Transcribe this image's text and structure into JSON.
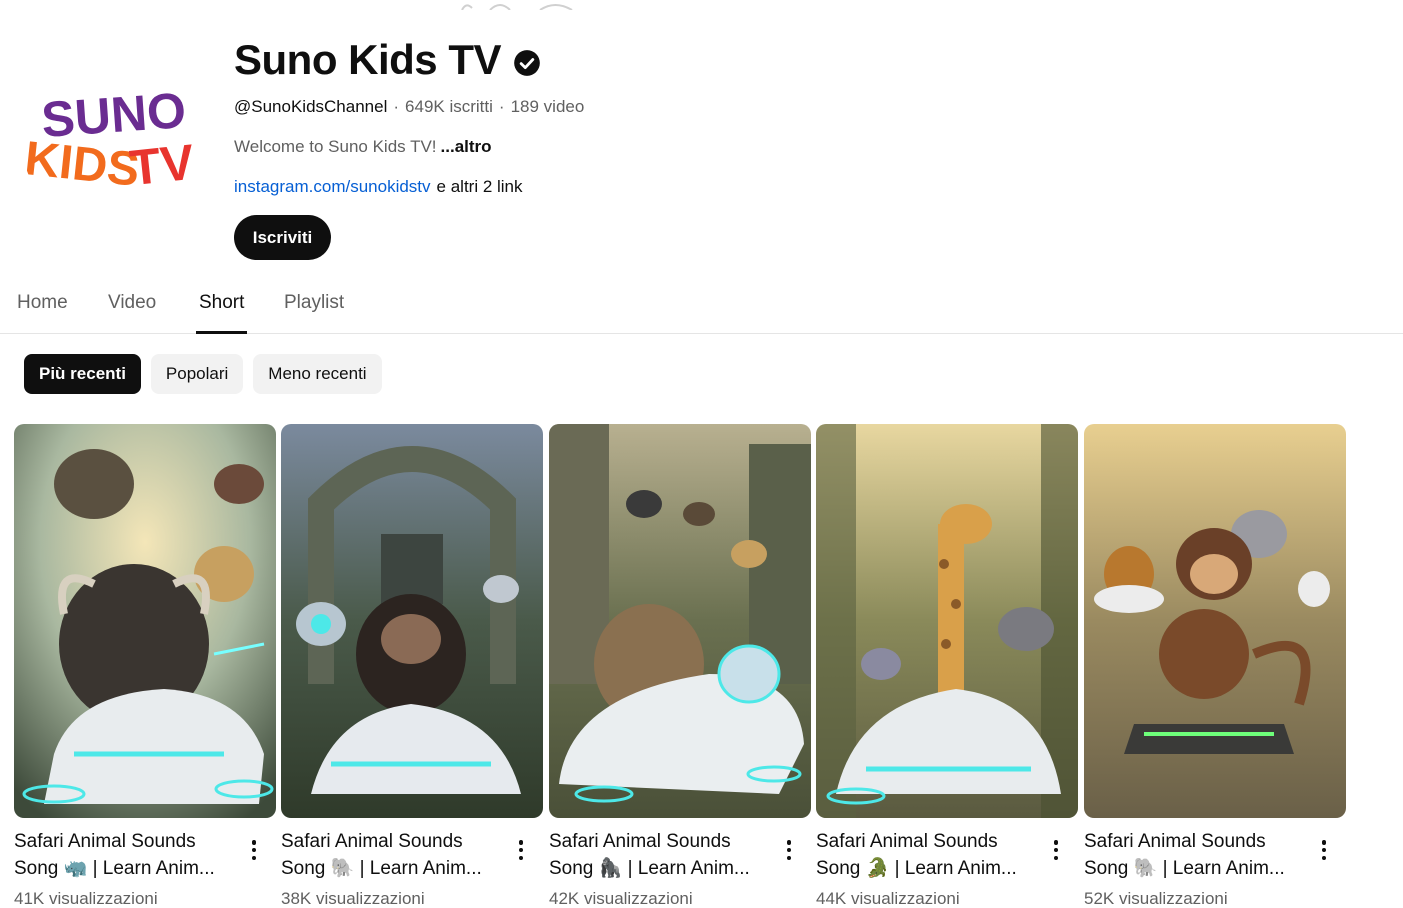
{
  "channel": {
    "name": "Suno Kids TV",
    "handle": "@SunoKidsChannel",
    "subscribers": "649K iscritti",
    "video_count": "189 video",
    "separator": "·",
    "description": "Welcome to Suno Kids TV!",
    "more_label": "...altro",
    "link": "instagram.com/sunokidstv",
    "more_links": "e altri 2 link",
    "subscribe_label": "Iscriviti",
    "logo_text_top": "SUNO",
    "logo_text_bottom": "KIDSTV",
    "colors": {
      "logo_purple": "#6a2c91",
      "logo_orange": "#f26b1d",
      "logo_red": "#e8342e",
      "link": "#065fd4"
    }
  },
  "tabs": [
    {
      "label": "Home",
      "active": false
    },
    {
      "label": "Video",
      "active": false
    },
    {
      "label": "Short",
      "active": true
    },
    {
      "label": "Playlist",
      "active": false
    }
  ],
  "chips": [
    {
      "label": "Più recenti",
      "active": true
    },
    {
      "label": "Popolari",
      "active": false
    },
    {
      "label": "Meno recenti",
      "active": false
    }
  ],
  "shorts": [
    {
      "title_line1": "Safari Animal Sounds",
      "title_line2": "Song 🦏 | Learn Anim...",
      "views": "41K visualizzazioni",
      "scene": "buffalo"
    },
    {
      "title_line1": "Safari Animal Sounds",
      "title_line2": "Song 🐘 | Learn Anim...",
      "views": "38K visualizzazioni",
      "scene": "chimp"
    },
    {
      "title_line1": "Safari Animal Sounds",
      "title_line2": "Song 🦍 | Learn Anim...",
      "views": "42K visualizzazioni",
      "scene": "hyena"
    },
    {
      "title_line1": "Safari Animal Sounds",
      "title_line2": "Song 🐊 | Learn Anim...",
      "views": "44K visualizzazioni",
      "scene": "giraffe"
    },
    {
      "title_line1": "Safari Animal Sounds",
      "title_line2": "Song 🐘 | Learn Anim...",
      "views": "52K visualizzazioni",
      "scene": "monkey"
    }
  ]
}
